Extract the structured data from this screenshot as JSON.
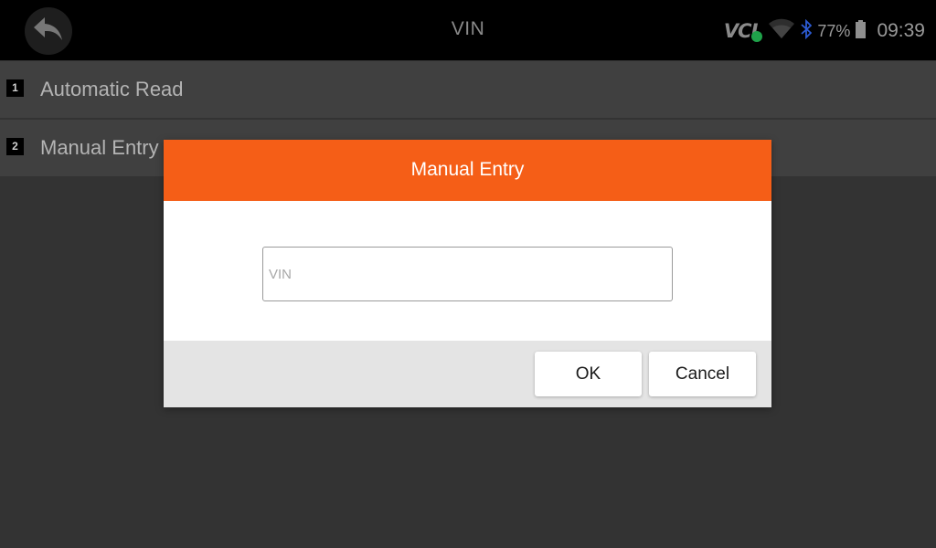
{
  "header": {
    "title": "VIN",
    "back_icon": "back-arrow-icon"
  },
  "status_bar": {
    "vci_label": "VCI",
    "vci_status_color": "#1fa24a",
    "wifi_icon": "wifi-icon",
    "bluetooth_icon": "bluetooth-icon",
    "battery_percent": "77%",
    "battery_icon": "battery-icon",
    "time": "09:39"
  },
  "menu": {
    "items": [
      {
        "index": "1",
        "label": "Automatic Read"
      },
      {
        "index": "2",
        "label": "Manual Entry"
      }
    ]
  },
  "dialog": {
    "title": "Manual Entry",
    "header_color": "#f55e17",
    "vin_field": {
      "value": "",
      "placeholder": "VIN"
    },
    "ok_label": "OK",
    "cancel_label": "Cancel"
  }
}
